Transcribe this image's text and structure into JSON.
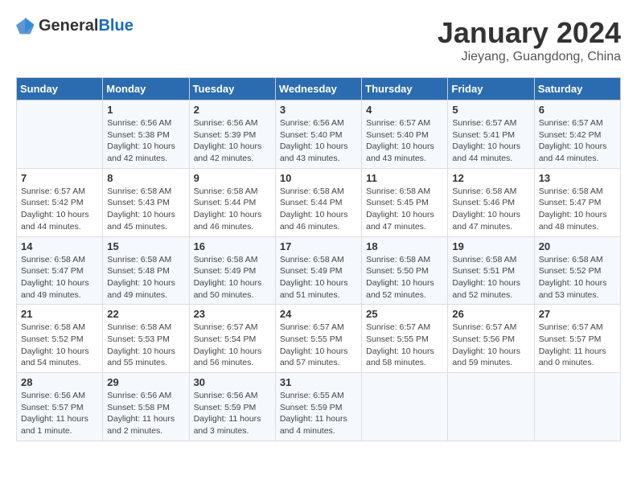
{
  "header": {
    "logo_general": "General",
    "logo_blue": "Blue",
    "title": "January 2024",
    "location": "Jieyang, Guangdong, China"
  },
  "days_of_week": [
    "Sunday",
    "Monday",
    "Tuesday",
    "Wednesday",
    "Thursday",
    "Friday",
    "Saturday"
  ],
  "weeks": [
    [
      {
        "day": "",
        "info": ""
      },
      {
        "day": "1",
        "info": "Sunrise: 6:56 AM\nSunset: 5:38 PM\nDaylight: 10 hours\nand 42 minutes."
      },
      {
        "day": "2",
        "info": "Sunrise: 6:56 AM\nSunset: 5:39 PM\nDaylight: 10 hours\nand 42 minutes."
      },
      {
        "day": "3",
        "info": "Sunrise: 6:56 AM\nSunset: 5:40 PM\nDaylight: 10 hours\nand 43 minutes."
      },
      {
        "day": "4",
        "info": "Sunrise: 6:57 AM\nSunset: 5:40 PM\nDaylight: 10 hours\nand 43 minutes."
      },
      {
        "day": "5",
        "info": "Sunrise: 6:57 AM\nSunset: 5:41 PM\nDaylight: 10 hours\nand 44 minutes."
      },
      {
        "day": "6",
        "info": "Sunrise: 6:57 AM\nSunset: 5:42 PM\nDaylight: 10 hours\nand 44 minutes."
      }
    ],
    [
      {
        "day": "7",
        "info": "Sunrise: 6:57 AM\nSunset: 5:42 PM\nDaylight: 10 hours\nand 44 minutes."
      },
      {
        "day": "8",
        "info": "Sunrise: 6:58 AM\nSunset: 5:43 PM\nDaylight: 10 hours\nand 45 minutes."
      },
      {
        "day": "9",
        "info": "Sunrise: 6:58 AM\nSunset: 5:44 PM\nDaylight: 10 hours\nand 46 minutes."
      },
      {
        "day": "10",
        "info": "Sunrise: 6:58 AM\nSunset: 5:44 PM\nDaylight: 10 hours\nand 46 minutes."
      },
      {
        "day": "11",
        "info": "Sunrise: 6:58 AM\nSunset: 5:45 PM\nDaylight: 10 hours\nand 47 minutes."
      },
      {
        "day": "12",
        "info": "Sunrise: 6:58 AM\nSunset: 5:46 PM\nDaylight: 10 hours\nand 47 minutes."
      },
      {
        "day": "13",
        "info": "Sunrise: 6:58 AM\nSunset: 5:47 PM\nDaylight: 10 hours\nand 48 minutes."
      }
    ],
    [
      {
        "day": "14",
        "info": "Sunrise: 6:58 AM\nSunset: 5:47 PM\nDaylight: 10 hours\nand 49 minutes."
      },
      {
        "day": "15",
        "info": "Sunrise: 6:58 AM\nSunset: 5:48 PM\nDaylight: 10 hours\nand 49 minutes."
      },
      {
        "day": "16",
        "info": "Sunrise: 6:58 AM\nSunset: 5:49 PM\nDaylight: 10 hours\nand 50 minutes."
      },
      {
        "day": "17",
        "info": "Sunrise: 6:58 AM\nSunset: 5:49 PM\nDaylight: 10 hours\nand 51 minutes."
      },
      {
        "day": "18",
        "info": "Sunrise: 6:58 AM\nSunset: 5:50 PM\nDaylight: 10 hours\nand 52 minutes."
      },
      {
        "day": "19",
        "info": "Sunrise: 6:58 AM\nSunset: 5:51 PM\nDaylight: 10 hours\nand 52 minutes."
      },
      {
        "day": "20",
        "info": "Sunrise: 6:58 AM\nSunset: 5:52 PM\nDaylight: 10 hours\nand 53 minutes."
      }
    ],
    [
      {
        "day": "21",
        "info": "Sunrise: 6:58 AM\nSunset: 5:52 PM\nDaylight: 10 hours\nand 54 minutes."
      },
      {
        "day": "22",
        "info": "Sunrise: 6:58 AM\nSunset: 5:53 PM\nDaylight: 10 hours\nand 55 minutes."
      },
      {
        "day": "23",
        "info": "Sunrise: 6:57 AM\nSunset: 5:54 PM\nDaylight: 10 hours\nand 56 minutes."
      },
      {
        "day": "24",
        "info": "Sunrise: 6:57 AM\nSunset: 5:55 PM\nDaylight: 10 hours\nand 57 minutes."
      },
      {
        "day": "25",
        "info": "Sunrise: 6:57 AM\nSunset: 5:55 PM\nDaylight: 10 hours\nand 58 minutes."
      },
      {
        "day": "26",
        "info": "Sunrise: 6:57 AM\nSunset: 5:56 PM\nDaylight: 10 hours\nand 59 minutes."
      },
      {
        "day": "27",
        "info": "Sunrise: 6:57 AM\nSunset: 5:57 PM\nDaylight: 11 hours\nand 0 minutes."
      }
    ],
    [
      {
        "day": "28",
        "info": "Sunrise: 6:56 AM\nSunset: 5:57 PM\nDaylight: 11 hours\nand 1 minute."
      },
      {
        "day": "29",
        "info": "Sunrise: 6:56 AM\nSunset: 5:58 PM\nDaylight: 11 hours\nand 2 minutes."
      },
      {
        "day": "30",
        "info": "Sunrise: 6:56 AM\nSunset: 5:59 PM\nDaylight: 11 hours\nand 3 minutes."
      },
      {
        "day": "31",
        "info": "Sunrise: 6:55 AM\nSunset: 5:59 PM\nDaylight: 11 hours\nand 4 minutes."
      },
      {
        "day": "",
        "info": ""
      },
      {
        "day": "",
        "info": ""
      },
      {
        "day": "",
        "info": ""
      }
    ]
  ]
}
